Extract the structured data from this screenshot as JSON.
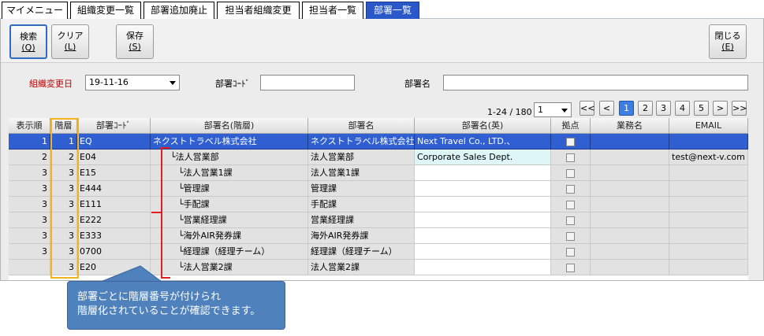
{
  "tabs": [
    {
      "label": "マイメニュー",
      "active": false
    },
    {
      "label": "組織変更一覧",
      "active": false
    },
    {
      "label": "部署追加廃止",
      "active": false
    },
    {
      "label": "担当者組織変更",
      "active": false
    },
    {
      "label": "担当者一覧",
      "active": false
    },
    {
      "label": "部署一覧",
      "active": true
    }
  ],
  "toolbar": {
    "search_label": "検索",
    "search_key": "(Q)",
    "clear_label": "クリア",
    "clear_key": "(L)",
    "save_label": "保存",
    "save_key": "(S)",
    "close_label": "閉じる",
    "close_key": "(E)"
  },
  "filters": {
    "org_change_date_label": "組織変更日",
    "org_change_date_value": "19-11-16",
    "dept_code_label": "部署ｺｰﾄﾞ",
    "dept_code_value": "",
    "dept_name_label": "部署名",
    "dept_name_value": ""
  },
  "pager": {
    "range_text": "1-24 / 180",
    "page_select_value": "1",
    "first_label": "<<",
    "prev_label": "<",
    "pages": [
      "1",
      "2",
      "3",
      "4",
      "5"
    ],
    "current_page": "1",
    "next_label": ">",
    "last_label": ">>"
  },
  "grid": {
    "columns": [
      "表示順",
      "階層",
      "部署ｺｰﾄﾞ",
      "部署名(階層)",
      "部署名",
      "部署名(英)",
      "拠点",
      "業務名",
      "EMAIL"
    ],
    "rows": [
      {
        "order": "1",
        "level": "1",
        "code": "EQ",
        "name_tree": "ネクストトラベル株式会社",
        "name": "ネクストトラベル株式会社",
        "name_en": "Next Travel Co., LTD.、",
        "business": "",
        "email": "",
        "selected": true
      },
      {
        "order": "2",
        "level": "2",
        "code": "E04",
        "name_tree": "└法人営業部",
        "name": "法人営業部",
        "name_en": "Corporate Sales Dept.",
        "business": "",
        "email": "test@next-v.com",
        "selected": false
      },
      {
        "order": "3",
        "level": "3",
        "code": "E15",
        "name_tree": "└法人営業1課",
        "name": "法人営業1課",
        "name_en": "",
        "business": "",
        "email": "",
        "selected": false
      },
      {
        "order": "3",
        "level": "3",
        "code": "E444",
        "name_tree": "└管理課",
        "name": "管理課",
        "name_en": "",
        "business": "",
        "email": "",
        "selected": false
      },
      {
        "order": "3",
        "level": "3",
        "code": "E111",
        "name_tree": "└手配課",
        "name": "手配課",
        "name_en": "",
        "business": "",
        "email": "",
        "selected": false
      },
      {
        "order": "3",
        "level": "3",
        "code": "E222",
        "name_tree": "└営業経理課",
        "name": "営業経理課",
        "name_en": "",
        "business": "",
        "email": "",
        "selected": false
      },
      {
        "order": "3",
        "level": "3",
        "code": "E333",
        "name_tree": "└海外AIR発券課",
        "name": "海外AIR発券課",
        "name_en": "",
        "business": "",
        "email": "",
        "selected": false
      },
      {
        "order": "3",
        "level": "3",
        "code": "0700",
        "name_tree": "└経理課（経理チーム）",
        "name": "経理課（経理チーム）",
        "name_en": "",
        "business": "",
        "email": "",
        "selected": false
      },
      {
        "order": "",
        "level": "3",
        "code": "E20",
        "name_tree": "└法人営業2課",
        "name": "法人営業2課",
        "name_en": "",
        "business": "",
        "email": "",
        "selected": false
      }
    ]
  },
  "annotation": {
    "line1": "部署ごとに階層番号が付けられ",
    "line2": "階層化されていることが確認できます。"
  },
  "colors": {
    "tab_active": "#2b58c8",
    "row_selected": "#2f5fd0",
    "highlight_box": "#f5b21c",
    "bracket": "#e02020",
    "callout": "#4f81bd",
    "label_red": "#c00000"
  }
}
